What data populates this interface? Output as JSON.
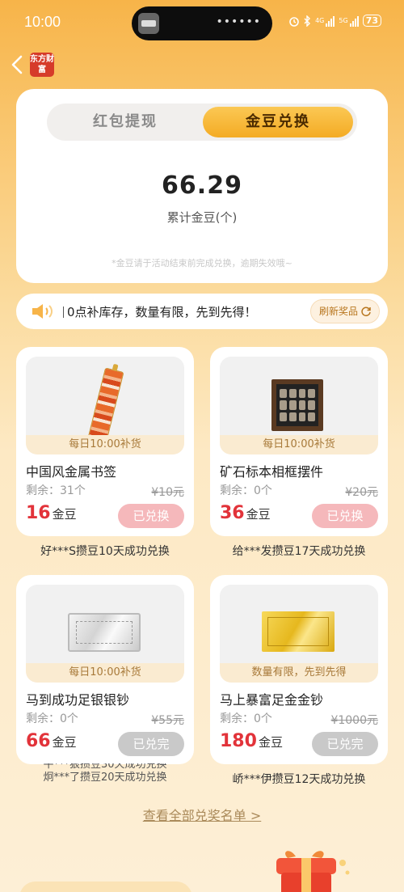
{
  "status_bar": {
    "time": "10:00",
    "signal_4g": "4G",
    "signal_5g": "5G",
    "battery": "73",
    "icons": [
      "alarm-icon",
      "bluetooth-icon",
      "signal-icon",
      "battery-icon"
    ]
  },
  "nav": {
    "back_icon": "chevron-left-icon",
    "logo_text": "东方财富"
  },
  "tabs": {
    "left": "红包提现",
    "right": "金豆兑换",
    "active": "right"
  },
  "balance": {
    "value": "66.29",
    "label": "累计金豆(个)",
    "note": "*金豆请于活动结束前完成兑换，逾期失效哦~"
  },
  "notice": {
    "text": "0点补库存，数量有限，先到先得！",
    "refresh_label": "刷新奖品"
  },
  "products": [
    {
      "restock": "每日10:00补货",
      "name": "中国风金属书签",
      "remain": "剩余：31个",
      "orig": "¥10元",
      "price": "16",
      "unit": "金豆",
      "button": "已兑换",
      "winner": "好***S攒豆10天成功兑换"
    },
    {
      "restock": "每日10:00补货",
      "name": "矿石标本相框摆件",
      "remain": "剩余：0个",
      "orig": "¥20元",
      "price": "36",
      "unit": "金豆",
      "button": "已兑换",
      "winner": "给***发攒豆17天成功兑换"
    },
    {
      "restock": "每日10:00补货",
      "name": "马到成功足银银钞",
      "remain": "剩余：0个",
      "orig": "¥55元",
      "price": "66",
      "unit": "金豆",
      "button": "已兑完",
      "winner_a": "牛***狠攒豆30天成功兑换",
      "winner_b": "炯***了攒豆20天成功兑换"
    },
    {
      "restock": "数量有限，先到先得",
      "name": "马上暴富足金金钞",
      "remain": "剩余：0个",
      "orig": "¥1000元",
      "price": "180",
      "unit": "金豆",
      "button": "已兑完",
      "winner": "峤***伊攒豆12天成功兑换"
    }
  ],
  "footer": {
    "view_all": "查看全部兑奖名单 >"
  },
  "colors": {
    "accent": "#f4ab24",
    "price": "#e2333a",
    "redeemed_button": "#f5b8bb",
    "soldout_button": "#c9c9c9"
  }
}
